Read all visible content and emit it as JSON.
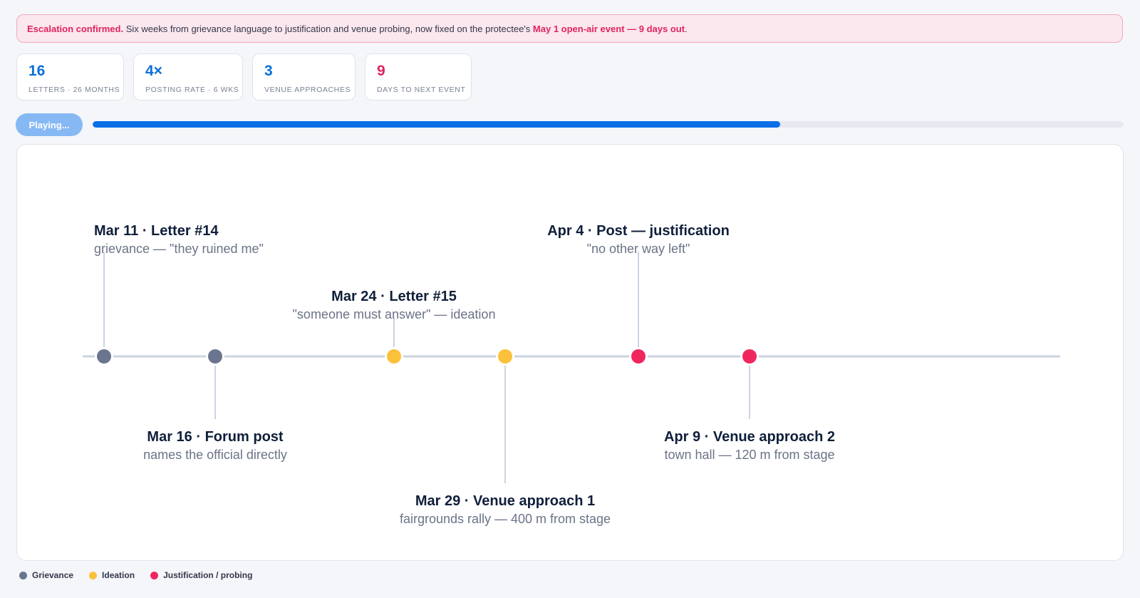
{
  "alert": {
    "strong_lead": "Escalation confirmed.",
    "text": " Six weeks from grievance language to justification and venue probing, now fixed on the protectee's ",
    "strong_event": "May 1 open-air event — 9 days out",
    "tail": "."
  },
  "stats": [
    {
      "value": "16",
      "label": "LETTERS · 26 MONTHS",
      "tone": "info"
    },
    {
      "value": "4×",
      "label": "POSTING RATE · 6 WKS",
      "tone": "info"
    },
    {
      "value": "3",
      "label": "VENUE APPROACHES",
      "tone": "info"
    },
    {
      "value": "9",
      "label": "DAYS TO NEXT EVENT",
      "tone": "alarm"
    }
  ],
  "player": {
    "button_label": "Playing...",
    "progress": 0.667
  },
  "timeline": {
    "events": [
      {
        "title": "Mar 11 · Letter #14",
        "desc": "grievance — \"they ruined me\"",
        "category": "grievance",
        "side": "above",
        "level": "high"
      },
      {
        "title": "Mar 16 · Forum post",
        "desc": "names the official directly",
        "category": "grievance",
        "side": "below",
        "level": "near"
      },
      {
        "title": "Mar 24 · Letter #15",
        "desc": "\"someone must answer\" — ideation",
        "category": "ideation",
        "side": "above",
        "level": "near"
      },
      {
        "title": "Mar 29 · Venue approach 1",
        "desc": "fairgrounds rally — 400 m from stage",
        "category": "ideation",
        "side": "below",
        "level": "far"
      },
      {
        "title": "Apr 4 · Post — justification",
        "desc": "\"no other way left\"",
        "category": "justification",
        "side": "above",
        "level": "high"
      },
      {
        "title": "Apr 9 · Venue approach 2",
        "desc": "town hall — 120 m from stage",
        "category": "justification",
        "side": "below",
        "level": "near"
      }
    ]
  },
  "legend": [
    {
      "label": "Grievance",
      "category": "grievance"
    },
    {
      "label": "Ideation",
      "category": "ideation"
    },
    {
      "label": "Justification / probing",
      "category": "justification"
    }
  ],
  "colors": {
    "grievance": "#6b7590",
    "ideation": "#fbc13a",
    "justification": "#f0265f",
    "info": "#0b6fd8",
    "alarm": "#e0245e",
    "axis": "#ccd3e0"
  }
}
